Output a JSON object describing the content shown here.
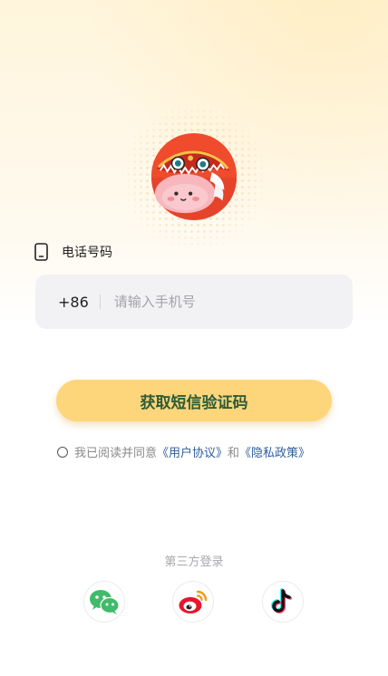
{
  "form": {
    "phone_label": "电话号码",
    "country_code": "+86",
    "phone_placeholder": "请输入手机号",
    "phone_value": ""
  },
  "actions": {
    "get_code_label": "获取短信验证码"
  },
  "agreement": {
    "checked": false,
    "prefix": "我已阅读并同意",
    "user_agreement": "《用户协议》",
    "conjunction": "和",
    "privacy_policy": "《隐私政策》"
  },
  "third_party": {
    "label": "第三方登录",
    "providers": [
      {
        "icon": "wechat-icon",
        "brand_color": "#3fbb6a"
      },
      {
        "icon": "weibo-icon",
        "brand_color": "#e6162d"
      },
      {
        "icon": "douyin-icon",
        "brand_color": "#111111"
      }
    ]
  },
  "colors": {
    "accent": "#fdd57b",
    "button_text": "#2e5b38",
    "link": "#2f5d9b",
    "input_bg": "#f2f2f4"
  }
}
